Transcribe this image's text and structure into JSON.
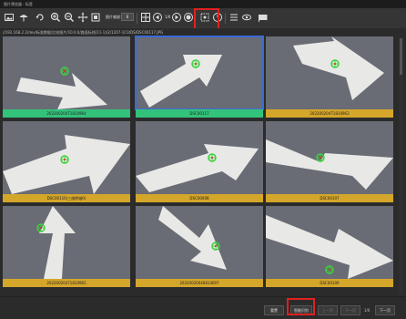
{
  "window": {
    "title": "图片预览器  · 标签"
  },
  "toolbar": {
    "zoom_label": "图片缩放：",
    "zoom_value": "6",
    "page_ratio": "1/6",
    "tooltip": "智能识别"
  },
  "path": {
    "text": "//192.168.2.2/dev/标准数据/比较图片/10.0.0/路面标线(11-1)/2/1207-1C0/DS/DSC00117.JPG"
  },
  "images": [
    {
      "caption": "20220020471810964",
      "status": "green",
      "selected": false
    },
    {
      "caption": "DSC00117",
      "status": "green",
      "selected": true
    },
    {
      "caption": "20220020471810963",
      "status": "yellow",
      "selected": false
    },
    {
      "caption": "DSC00116(三维转轴0)",
      "status": "yellow",
      "selected": false
    },
    {
      "caption": "DSC00008",
      "status": "yellow",
      "selected": false
    },
    {
      "caption": "DSC00107",
      "status": "yellow",
      "selected": false
    },
    {
      "caption": "20220020471810965",
      "status": "yellow",
      "selected": false
    },
    {
      "caption": "20220020046814697",
      "status": "yellow",
      "selected": false
    },
    {
      "caption": "DSC00109",
      "status": "yellow",
      "selected": false
    }
  ],
  "bottom": {
    "reset_label": "重置",
    "smart_label": "智能识别",
    "prev_label": "上一页",
    "next_label": "下一页",
    "page_info": "1/6",
    "next2_label": "下一页"
  },
  "colors": {
    "green": "#33c27a",
    "yellow": "#d4a62a",
    "highlight": "#e02020",
    "selected": "#3b6bd6"
  }
}
